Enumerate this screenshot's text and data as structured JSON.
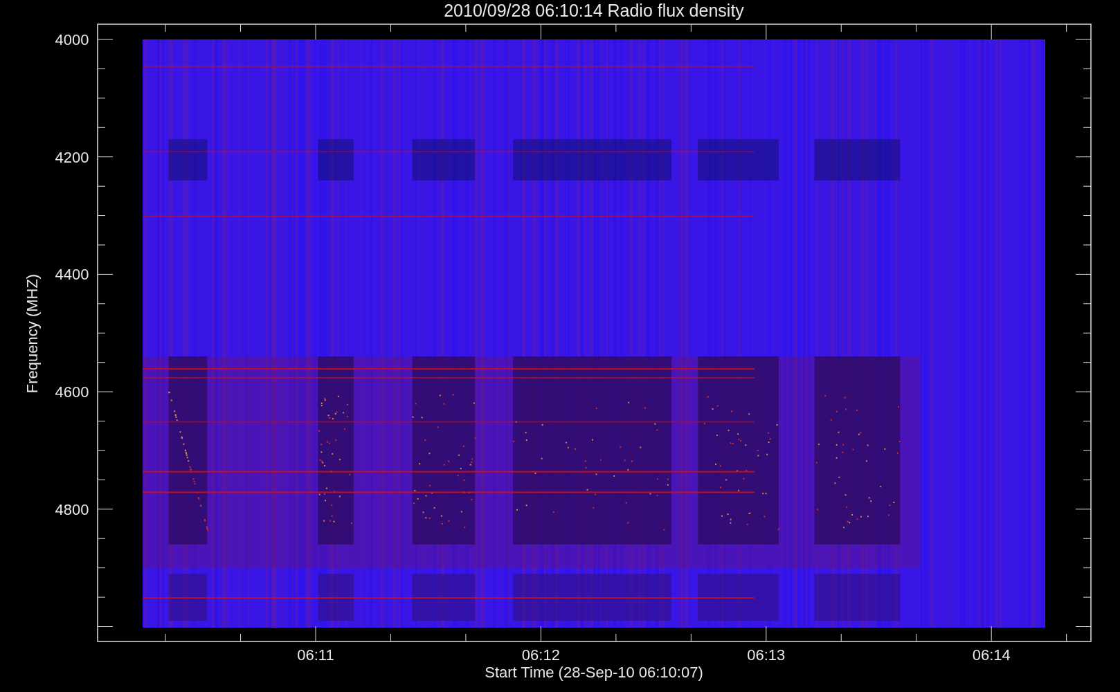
{
  "plot": {
    "title": "2010/09/28 06:10:14 Radio flux density",
    "ylabel": "Frequency (MHZ)",
    "xlabel": "Start Time (28-Sep-10 06:10:07)",
    "yticks": [
      "4000",
      "4200",
      "4400",
      "4600",
      "4800"
    ],
    "xticks": [
      "06:11",
      "06:12",
      "06:13",
      "06:14"
    ]
  }
}
